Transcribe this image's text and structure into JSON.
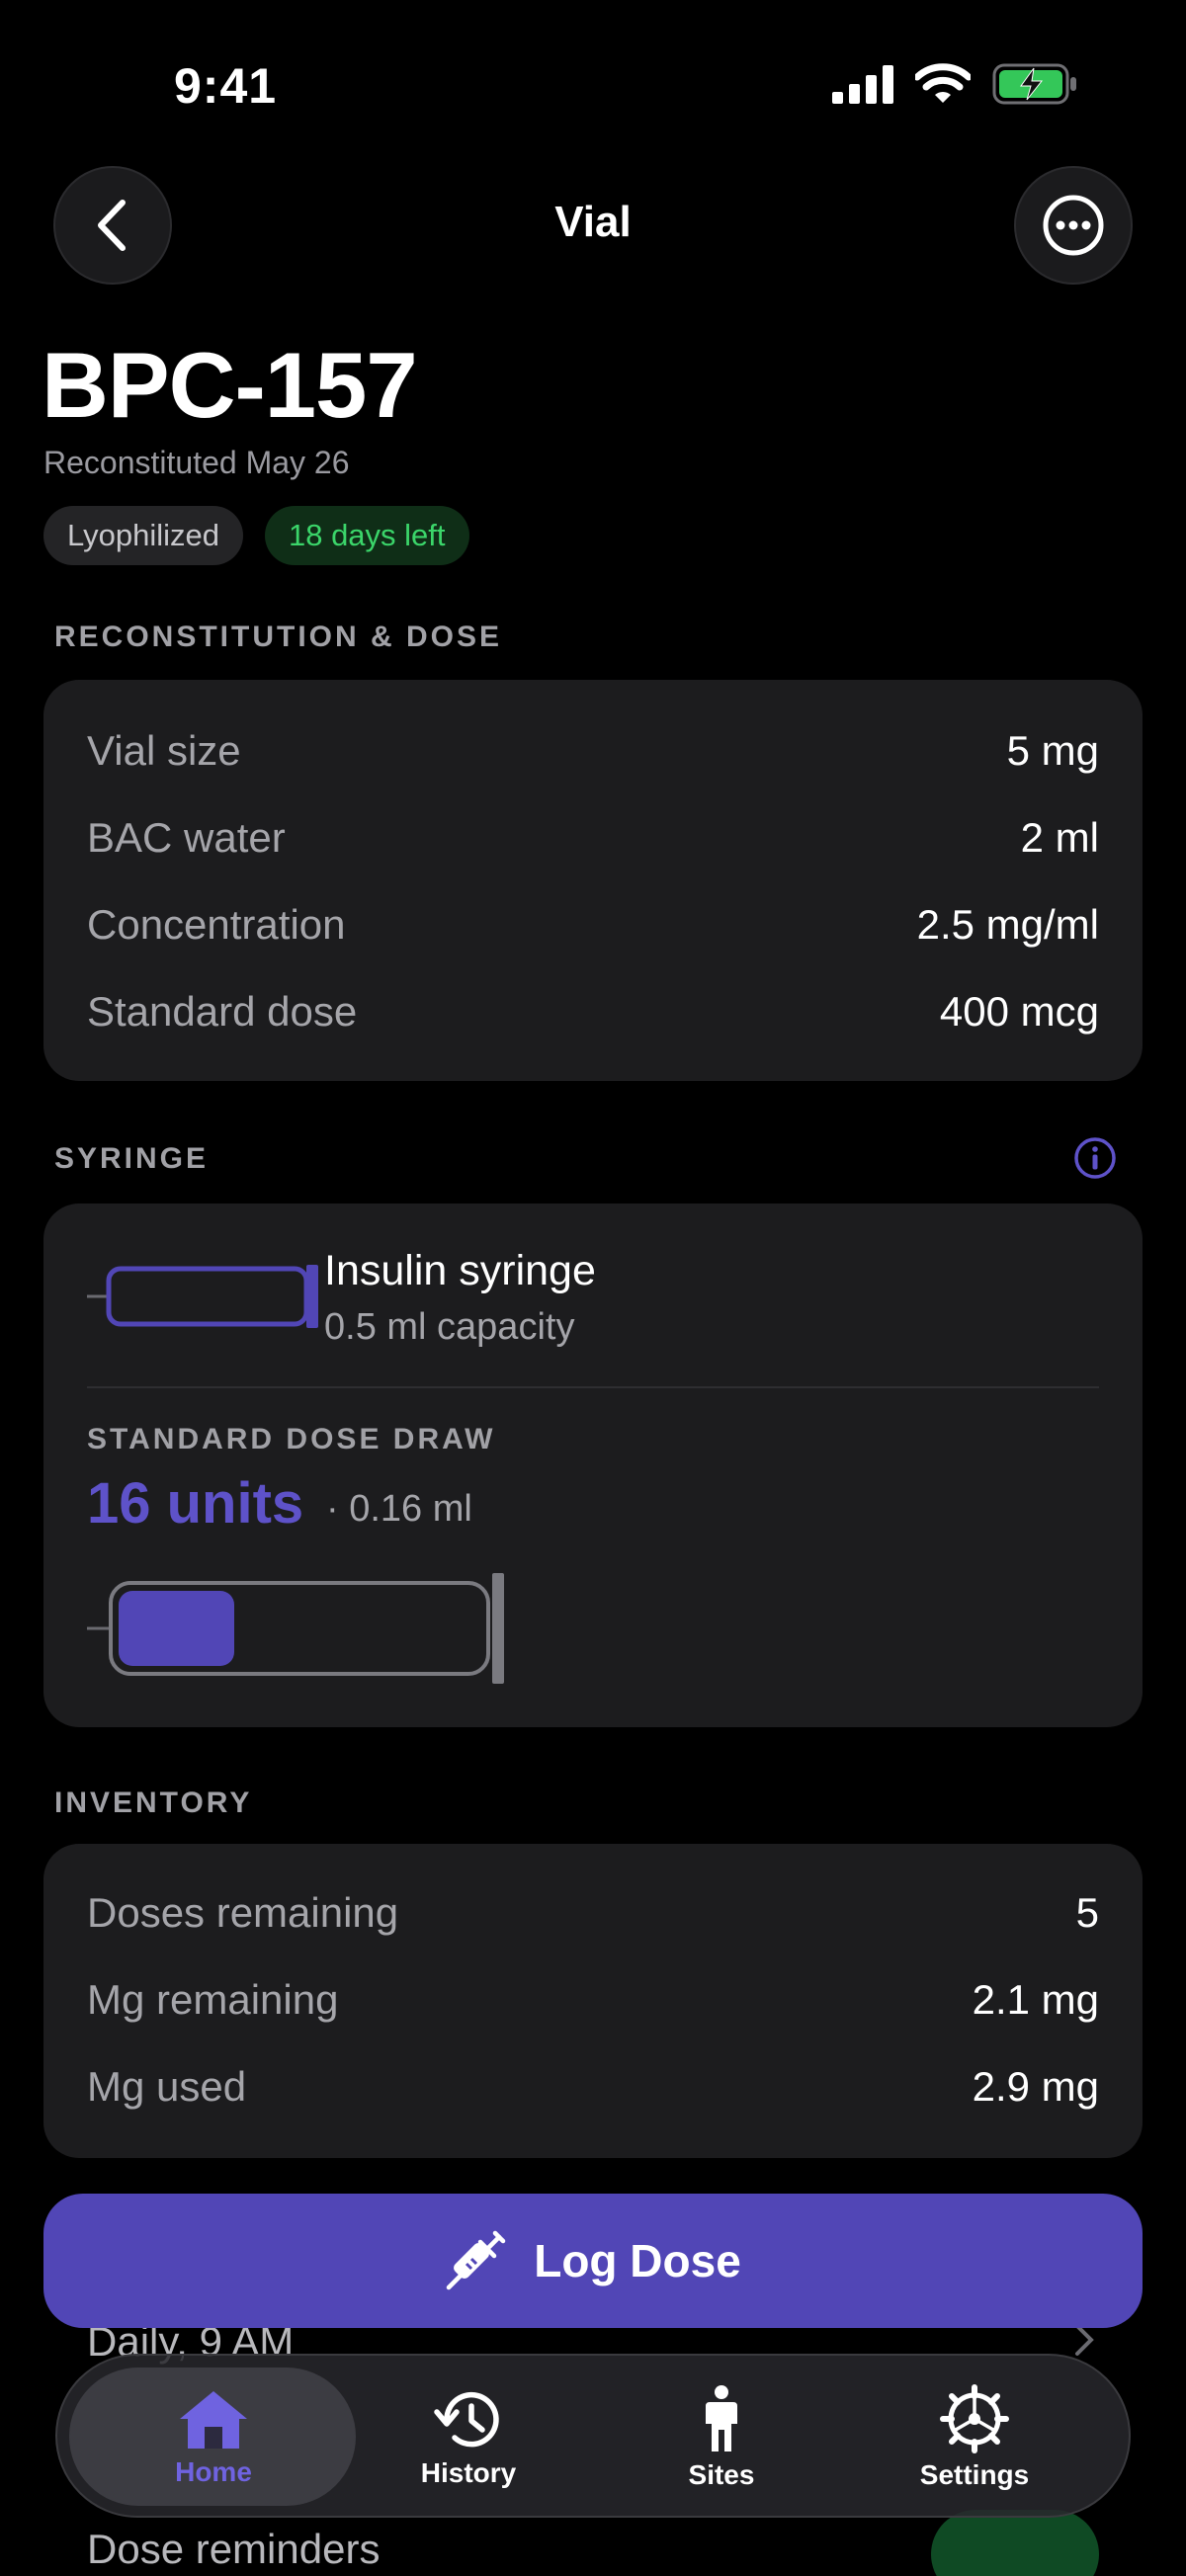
{
  "status_bar": {
    "time": "9:41"
  },
  "nav": {
    "title": "Vial"
  },
  "vial": {
    "name": "BPC-157",
    "subtitle": "Reconstituted May 26",
    "badges": [
      "Lyophilized",
      "18 days left"
    ]
  },
  "reconstitution": {
    "section_label": "RECONSTITUTION & DOSE",
    "rows": [
      {
        "label": "Vial size",
        "value": "5 mg"
      },
      {
        "label": "BAC water",
        "value": "2 ml"
      },
      {
        "label": "Concentration",
        "value": "2.5 mg/ml"
      },
      {
        "label": "Standard dose",
        "value": "400 mcg"
      }
    ]
  },
  "syringe": {
    "section_label": "SYRINGE",
    "name": "Insulin syringe",
    "capacity": "0.5 ml capacity",
    "draw_label": "STANDARD DOSE DRAW",
    "draw_units": "16 units",
    "draw_ml": "· 0.16 ml",
    "fill_fraction": 0.32
  },
  "inventory": {
    "section_label": "INVENTORY",
    "rows": [
      {
        "label": "Doses remaining",
        "value": "5"
      },
      {
        "label": "Mg remaining",
        "value": "2.1 mg"
      },
      {
        "label": "Mg used",
        "value": "2.9 mg"
      }
    ]
  },
  "log_button": {
    "label": "Log Dose"
  },
  "under_tab": {
    "schedule": "Daily, 9 AM",
    "reminders": "Dose reminders"
  },
  "tabs": [
    {
      "label": "Home",
      "icon": "home-icon",
      "active": true
    },
    {
      "label": "History",
      "icon": "history-icon",
      "active": false
    },
    {
      "label": "Sites",
      "icon": "person-icon",
      "active": false
    },
    {
      "label": "Settings",
      "icon": "gear-icon",
      "active": false
    }
  ],
  "colors": {
    "accent": "#5146B6",
    "accent_text": "#6F63E0",
    "success": "#3BD56A",
    "card": "#1C1C1E"
  }
}
